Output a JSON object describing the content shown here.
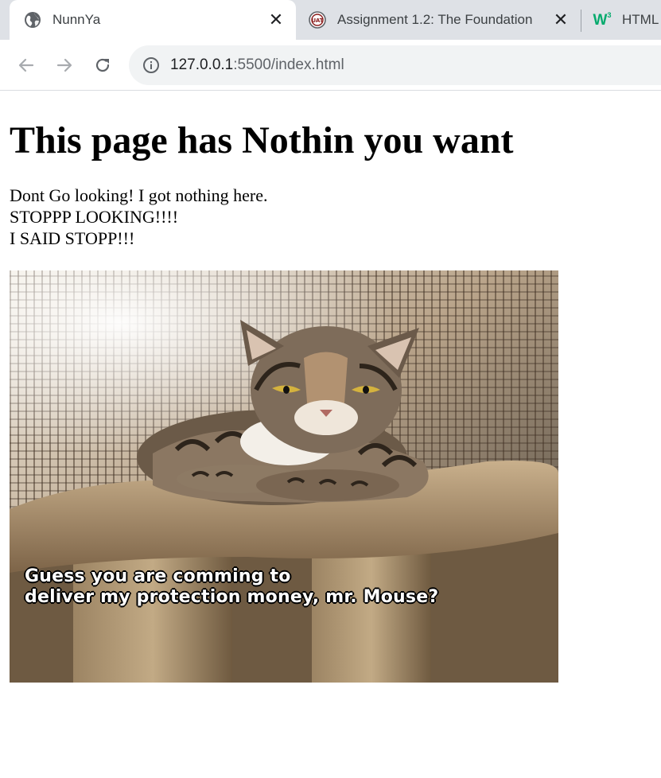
{
  "browser": {
    "tabs": [
      {
        "title": "NunnYa",
        "favicon": "globe-icon",
        "active": true
      },
      {
        "title": "Assignment 1.2: The Foundation",
        "favicon": "uat-logo-icon",
        "active": false
      },
      {
        "title": "HTML",
        "favicon": "w3schools-logo-icon",
        "active": false
      }
    ],
    "address": {
      "host": "127.0.0.1",
      "rest": ":5500/index.html"
    }
  },
  "page": {
    "heading": "This page has Nothin you want",
    "lines": [
      "Dont Go looking! I got nothing here.",
      "STOPPP LOOKING!!!!",
      "I SAID STOPP!!!"
    ],
    "image": {
      "caption_lines": [
        "Guess you are comming to",
        "deliver my protection money, mr. Mouse?"
      ]
    }
  },
  "colors": {
    "tabstrip_bg": "#dee1e6",
    "omnibox_bg": "#f1f3f4",
    "w3_green": "#04aa6d"
  }
}
